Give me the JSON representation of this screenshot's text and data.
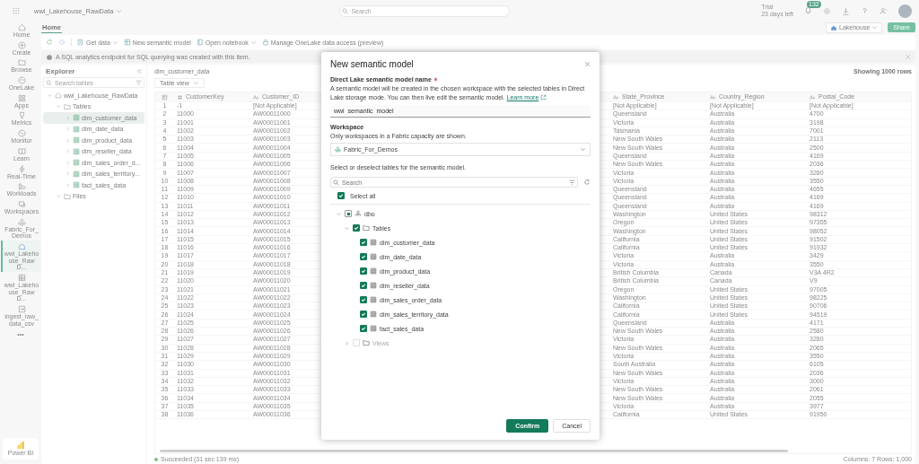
{
  "app_bar": {
    "item_name": "wwi_Lakehouse_RawData",
    "search": {
      "placeholder": "Search"
    },
    "trial": {
      "label": "Trial",
      "days": "23 days left"
    },
    "notifications": "132"
  },
  "nav_rail": {
    "items": [
      {
        "label": "Home",
        "kind": "home",
        "selected": false
      },
      {
        "label": "Create",
        "kind": "create",
        "selected": false
      },
      {
        "label": "Browse",
        "kind": "browse",
        "selected": false
      },
      {
        "label": "OneLake",
        "kind": "onelake",
        "selected": false
      },
      {
        "label": "Apps",
        "kind": "apps",
        "selected": false
      },
      {
        "label": "Metrics",
        "kind": "metrics",
        "selected": false
      },
      {
        "label": "Monitor",
        "kind": "monitor",
        "selected": false
      },
      {
        "label": "Learn",
        "kind": "learn",
        "selected": false
      },
      {
        "label": "Real-Time",
        "kind": "realtime",
        "selected": false
      },
      {
        "label": "Workloads",
        "kind": "workloads",
        "selected": false
      },
      {
        "label": "Workspaces",
        "kind": "workspaces",
        "selected": false
      },
      {
        "label": "Fabric_For_Demos",
        "kind": "workspace",
        "selected": false
      },
      {
        "label": "wwi_Lakehouse_RawD...",
        "kind": "lakehouse",
        "selected": true
      },
      {
        "label": "wwi_Lakehouse_RawD...",
        "kind": "endpoint",
        "selected": false
      },
      {
        "label": "ingest_raw_data_csv",
        "kind": "pipeline",
        "selected": false
      }
    ],
    "more": "•••",
    "footer": "Power BI"
  },
  "tabs": [
    {
      "label": "Home",
      "selected": true
    }
  ],
  "toolbar": {
    "items": [
      {
        "label": "Get data",
        "kind": "get-data",
        "dropdown": true
      },
      {
        "label": "New semantic model",
        "kind": "semantic-model",
        "dropdown": false
      },
      {
        "label": "Open notebook",
        "kind": "notebook",
        "dropdown": true
      },
      {
        "label": "Manage OneLake data access (preview)",
        "kind": "access",
        "dropdown": false
      }
    ],
    "lakehouse_menu": "Lakehouse",
    "share": "Share"
  },
  "banner": {
    "text": "A SQL analytics endpoint for SQL querying was created with this item."
  },
  "explorer": {
    "title": "Explorer",
    "search": {
      "placeholder": "Search tables"
    },
    "tree": [
      {
        "label": "wwi_Lakehouse_RawData",
        "kind": "lakehouse",
        "expanded": true,
        "children": [
          {
            "label": "Tables",
            "kind": "folder",
            "expanded": true,
            "children": [
              {
                "label": "dim_customer_data",
                "kind": "table",
                "expanded": false,
                "selected": true
              },
              {
                "label": "dim_date_data",
                "kind": "table",
                "expanded": false,
                "selected": false
              },
              {
                "label": "dim_product_data",
                "kind": "table",
                "expanded": false,
                "selected": false
              },
              {
                "label": "dim_reseller_data",
                "kind": "table",
                "expanded": false,
                "selected": false
              },
              {
                "label": "dim_sales_order_d...",
                "kind": "table",
                "expanded": false,
                "selected": false
              },
              {
                "label": "dim_sales_territory...",
                "kind": "table",
                "expanded": false,
                "selected": false
              },
              {
                "label": "fact_sales_data",
                "kind": "table",
                "expanded": false,
                "selected": false
              }
            ]
          },
          {
            "label": "Files",
            "kind": "folder",
            "expanded": true
          }
        ]
      }
    ]
  },
  "data_view": {
    "title": "dim_customer_data",
    "row_count": "Showing 1000 rows",
    "view_select": "Table view",
    "table": {
      "columns": [
        {
          "name": "CustomerKey",
          "kind": "number"
        },
        {
          "name": "Customer_ID",
          "kind": "text"
        },
        {
          "name": "State_Province",
          "kind": "text"
        },
        {
          "name": "Country_Region",
          "kind": "text"
        },
        {
          "name": "Postal_Code",
          "kind": "text"
        }
      ],
      "rows": [
        {
          "index": "1",
          "cells": [
            "-1",
            "[Not Applicable]",
            "[Not Applicable]",
            "[Not Applicable]",
            "[Not Applicable]"
          ]
        },
        {
          "index": "2",
          "cells": [
            "11000",
            "AW00011000",
            "Queensland",
            "Australia",
            "4700"
          ]
        },
        {
          "index": "3",
          "cells": [
            "11001",
            "AW00011001",
            "Victoria",
            "Australia",
            "3198"
          ]
        },
        {
          "index": "4",
          "cells": [
            "11002",
            "AW00011002",
            "Tasmania",
            "Australia",
            "7001"
          ]
        },
        {
          "index": "5",
          "cells": [
            "11003",
            "AW00011003",
            "New South Wales",
            "Australia",
            "2113"
          ]
        },
        {
          "index": "6",
          "cells": [
            "11004",
            "AW00011004",
            "New South Wales",
            "Australia",
            "2500"
          ]
        },
        {
          "index": "7",
          "cells": [
            "11005",
            "AW00011005",
            "Queensland",
            "Australia",
            "4169"
          ]
        },
        {
          "index": "8",
          "cells": [
            "11006",
            "AW00011006",
            "New South Wales",
            "Australia",
            "2036"
          ]
        },
        {
          "index": "9",
          "cells": [
            "11007",
            "AW00011007",
            "Victoria",
            "Australia",
            "3280"
          ]
        },
        {
          "index": "10",
          "cells": [
            "11008",
            "AW00011008",
            "Victoria",
            "Australia",
            "3550"
          ]
        },
        {
          "index": "11",
          "cells": [
            "11009",
            "AW00011009",
            "Queensland",
            "Australia",
            "4655"
          ]
        },
        {
          "index": "12",
          "cells": [
            "11010",
            "AW00011010",
            "Queensland",
            "Australia",
            "4169"
          ]
        },
        {
          "index": "13",
          "cells": [
            "11011",
            "AW00011011",
            "Queensland",
            "Australia",
            "4169"
          ]
        },
        {
          "index": "14",
          "cells": [
            "11012",
            "AW00011012",
            "Washington",
            "United States",
            "98312"
          ]
        },
        {
          "index": "15",
          "cells": [
            "11013",
            "AW00011013",
            "Oregon",
            "United States",
            "97355"
          ]
        },
        {
          "index": "16",
          "cells": [
            "11014",
            "AW00011014",
            "Washington",
            "United States",
            "98052"
          ]
        },
        {
          "index": "17",
          "cells": [
            "11015",
            "AW00011015",
            "California",
            "United States",
            "91502"
          ]
        },
        {
          "index": "18",
          "cells": [
            "11016",
            "AW00011016",
            "California",
            "United States",
            "91932"
          ]
        },
        {
          "index": "19",
          "cells": [
            "11017",
            "AW00011017",
            "Victoria",
            "Australia",
            "3429"
          ]
        },
        {
          "index": "20",
          "cells": [
            "11018",
            "AW00011018",
            "Victoria",
            "Australia",
            "3550"
          ]
        },
        {
          "index": "21",
          "cells": [
            "11019",
            "AW00011019",
            "British Columbia",
            "Canada",
            "V3A 4R2"
          ]
        },
        {
          "index": "22",
          "cells": [
            "11020",
            "AW00011020",
            "British Columbia",
            "Canada",
            "V9"
          ]
        },
        {
          "index": "23",
          "cells": [
            "11021",
            "AW00011021",
            "Oregon",
            "United States",
            "97005"
          ]
        },
        {
          "index": "24",
          "cells": [
            "11022",
            "AW00011022",
            "Washington",
            "United States",
            "98225"
          ]
        },
        {
          "index": "25",
          "cells": [
            "11023",
            "AW00011023",
            "California",
            "United States",
            "90706"
          ]
        },
        {
          "index": "26",
          "cells": [
            "11024",
            "AW00011024",
            "California",
            "United States",
            "94519"
          ]
        },
        {
          "index": "27",
          "cells": [
            "11025",
            "AW00011025",
            "Queensland",
            "Australia",
            "4171"
          ]
        },
        {
          "index": "28",
          "cells": [
            "11026",
            "AW00011026",
            "New South Wales",
            "Australia",
            "2580"
          ]
        },
        {
          "index": "29",
          "cells": [
            "11027",
            "AW00011027",
            "Victoria",
            "Australia",
            "3280"
          ]
        },
        {
          "index": "30",
          "cells": [
            "11028",
            "AW00011028",
            "New South Wales",
            "Australia",
            "2065"
          ]
        },
        {
          "index": "31",
          "cells": [
            "11029",
            "AW00011029",
            "Victoria",
            "Australia",
            "3550"
          ]
        },
        {
          "index": "32",
          "cells": [
            "11030",
            "AW00011030",
            "South Australia",
            "Australia",
            "6105"
          ]
        },
        {
          "index": "33",
          "cells": [
            "11031",
            "AW00011031",
            "New South Wales",
            "Australia",
            "2036"
          ]
        },
        {
          "index": "34",
          "cells": [
            "11032",
            "AW00011032",
            "Victoria",
            "Australia",
            "3000"
          ]
        },
        {
          "index": "35",
          "cells": [
            "11033",
            "AW00011033",
            "New South Wales",
            "Australia",
            "2061"
          ]
        },
        {
          "index": "36",
          "cells": [
            "11034",
            "AW00011034",
            "New South Wales",
            "Australia",
            "2055"
          ]
        },
        {
          "index": "37",
          "cells": [
            "11035",
            "AW00011035",
            "Victoria",
            "Australia",
            "3977"
          ]
        },
        {
          "index": "38",
          "cells": [
            "11036",
            "AW00011036",
            "California",
            "United States",
            "91950"
          ]
        }
      ]
    },
    "status": "Succeeded (31 sec 139 ms)",
    "summary": "Columns: 7 Rows: 1,000"
  },
  "dialog": {
    "title": "New semantic model",
    "name_field": {
      "label": "Direct Lake semantic model name",
      "required": true,
      "value": "wwi_semantic_model"
    },
    "description": "A semantic model will be created in the chosen workspace with the selected tables in Direct Lake storage mode. You can then live edit the semantic model.",
    "link": "Learn more",
    "workspace": {
      "label": "Workspace",
      "hint": "Only workspaces in a Fabric capacity are shown.",
      "value": "Fabric_For_Demos"
    },
    "tables_hint": "Select or deselect tables for the semantic model.",
    "search": {
      "placeholder": "Search"
    },
    "select_all": {
      "label": "Select all",
      "checked": true
    },
    "tree": [
      {
        "label": "dbo",
        "kind": "schema",
        "expanded": true,
        "indeterminate": true,
        "disabled": false,
        "children": [
          {
            "label": "Tables",
            "kind": "folder",
            "expanded": true,
            "checked": true,
            "disabled": false,
            "children": [
              {
                "label": "dim_customer_data",
                "kind": "table",
                "checked": true,
                "disabled": false
              },
              {
                "label": "dim_date_data",
                "kind": "table",
                "checked": true,
                "disabled": false
              },
              {
                "label": "dim_product_data",
                "kind": "table",
                "checked": true,
                "disabled": false
              },
              {
                "label": "dim_reseller_data",
                "kind": "table",
                "checked": true,
                "disabled": false
              },
              {
                "label": "dim_sales_order_data",
                "kind": "table",
                "checked": true,
                "disabled": false
              },
              {
                "label": "dim_sales_territory_data",
                "kind": "table",
                "checked": true,
                "disabled": false
              },
              {
                "label": "fact_sales_data",
                "kind": "table",
                "checked": true,
                "disabled": false
              }
            ]
          },
          {
            "label": "Views",
            "kind": "folder",
            "expanded": false,
            "checked": false,
            "disabled": true
          }
        ]
      }
    ],
    "buttons": [
      {
        "label": "Confirm",
        "kind": "primary"
      },
      {
        "label": "Cancel",
        "kind": "secondary"
      }
    ]
  }
}
